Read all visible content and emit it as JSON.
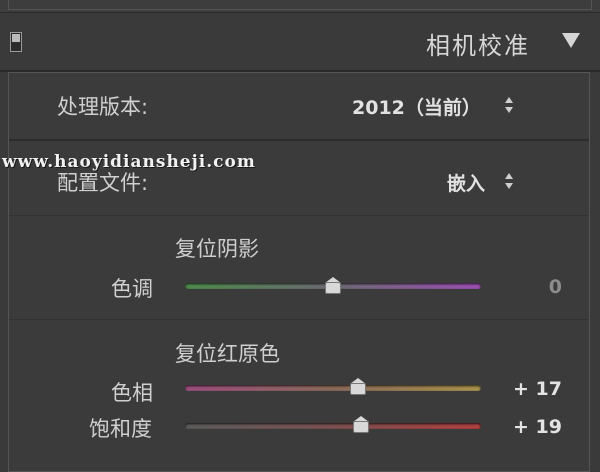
{
  "header": {
    "title": "相机校准",
    "collapse_icon": "triangle-down-icon"
  },
  "process": {
    "label": "处理版本:",
    "value": "2012（当前）"
  },
  "profile": {
    "label": "配置文件:",
    "value": "嵌入"
  },
  "watermark": "www.haoyidiansheji.com",
  "shadows": {
    "title": "复位阴影",
    "sliders": [
      {
        "label": "色调",
        "value": "0",
        "level": 0.5
      }
    ]
  },
  "red_primary": {
    "title": "复位红原色",
    "sliders": [
      {
        "label": "色相",
        "value": "+ 17",
        "level": 0.585
      },
      {
        "label": "饱和度",
        "value": "+ 19",
        "level": 0.595
      }
    ]
  }
}
